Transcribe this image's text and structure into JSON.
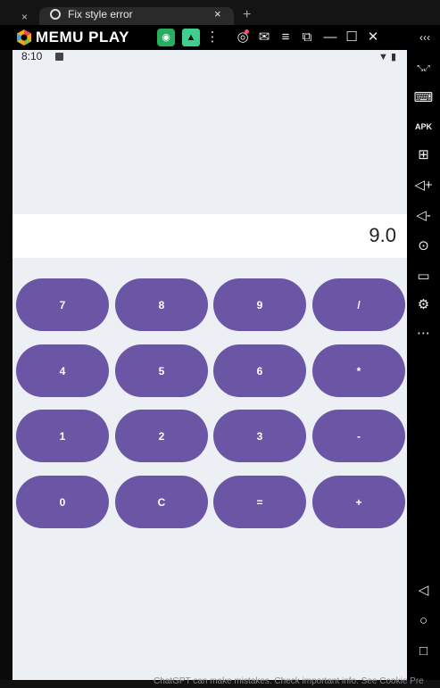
{
  "browser": {
    "tab_title": "Fix style error",
    "tab_close": "×",
    "new_tab": "+",
    "close_left": "×"
  },
  "emulator": {
    "brand": "MEMU PLAY",
    "toolbar_icons": [
      "store-icon",
      "android-icon",
      "more-vertical-icon",
      "account-icon",
      "mail-icon",
      "menu-icon",
      "screen-icon",
      "minimize-icon",
      "maximize-icon",
      "close-icon"
    ],
    "collapse_label": "‹‹‹"
  },
  "status": {
    "time": "8:10",
    "right": "▼ ▮"
  },
  "calculator": {
    "display": "9.0",
    "rows": [
      [
        "7",
        "8",
        "9",
        "/"
      ],
      [
        "4",
        "5",
        "6",
        "*"
      ],
      [
        "1",
        "2",
        "3",
        "-"
      ],
      [
        "0",
        "C",
        "=",
        "+"
      ]
    ],
    "button_color": "#6b56a5"
  },
  "sidebar_icons": [
    "fullscreen-icon",
    "keyboard-icon",
    "apk-icon",
    "add-window-icon",
    "volume-up-icon",
    "volume-down-icon",
    "location-icon",
    "folder-icon",
    "settings-icon",
    "more-icon",
    "back-icon",
    "home-icon",
    "recents-icon"
  ],
  "footer": {
    "text": "ChatGPT can make mistakes. Check important info. See Cookie Pre"
  }
}
